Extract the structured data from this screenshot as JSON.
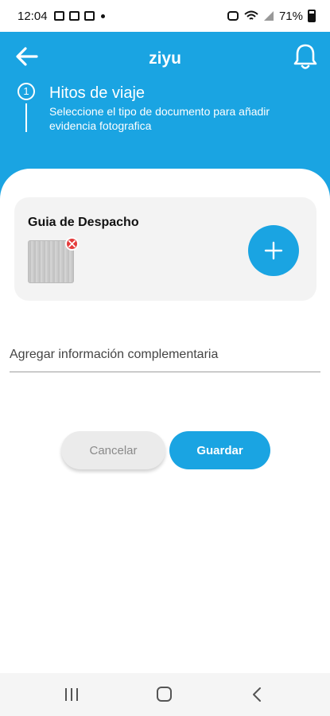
{
  "status": {
    "time": "12:04",
    "battery": "71%"
  },
  "header": {
    "title": "ziyu"
  },
  "step": {
    "number": "1",
    "title": "Hitos de viaje",
    "subtitle": "Seleccione el tipo de documento para añadir evidencia fotografica"
  },
  "document": {
    "title": "Guia de Despacho"
  },
  "extra_info": {
    "placeholder": "Agregar información complementaria",
    "value": ""
  },
  "actions": {
    "cancel_label": "Cancelar",
    "save_label": "Guardar"
  },
  "colors": {
    "primary": "#1aa4e2",
    "remove": "#e43b3b",
    "card": "#f3f3f3"
  },
  "icons": [
    "arrow-left-icon",
    "bell-icon",
    "plus-icon",
    "close-icon",
    "recent-apps-icon",
    "home-icon",
    "back-chevron-icon"
  ]
}
